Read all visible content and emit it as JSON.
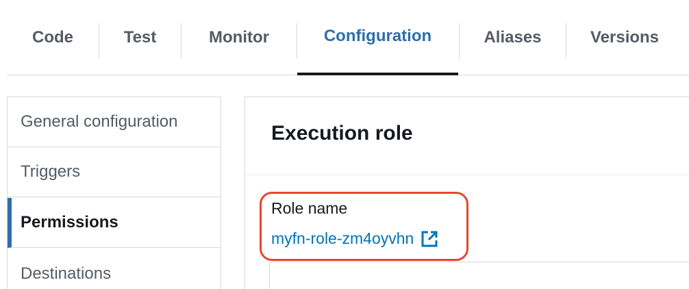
{
  "tabs": [
    {
      "label": "Code",
      "active": false
    },
    {
      "label": "Test",
      "active": false
    },
    {
      "label": "Monitor",
      "active": false
    },
    {
      "label": "Configuration",
      "active": true
    },
    {
      "label": "Aliases",
      "active": false
    },
    {
      "label": "Versions",
      "active": false
    }
  ],
  "side_menu": {
    "items": [
      {
        "label": "General configuration",
        "active": false
      },
      {
        "label": "Triggers",
        "active": false
      },
      {
        "label": "Permissions",
        "active": true
      },
      {
        "label": "Destinations",
        "active": false
      }
    ]
  },
  "execution_role": {
    "title": "Execution role",
    "role_name_label": "Role name",
    "role_name_value": "myfn-role-zm4oyvhn",
    "link_icon": "external-link-icon"
  },
  "colors": {
    "accent": "#2c6ead",
    "link": "#0073bb",
    "highlight": "#e8452c",
    "text_dark": "#16191f",
    "text_muted": "#545b64"
  }
}
